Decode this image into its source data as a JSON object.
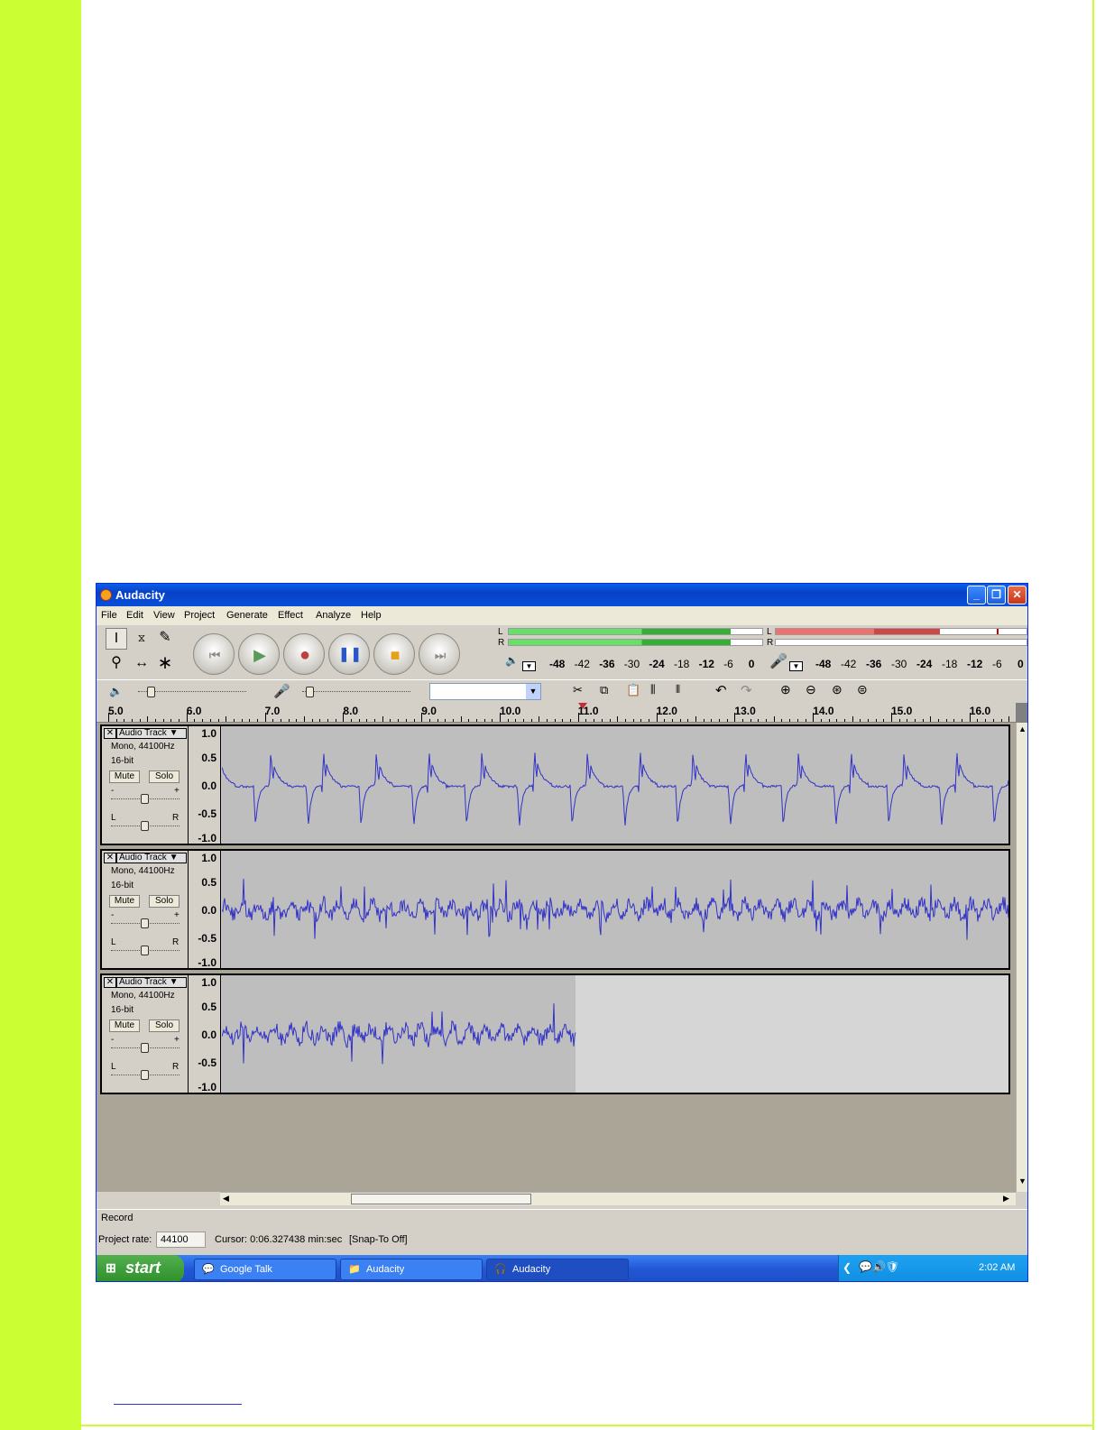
{
  "window": {
    "title": "Audacity",
    "minimize": "_",
    "restore": "❐",
    "close": "✕"
  },
  "menu": [
    "File",
    "Edit",
    "View",
    "Project",
    "Generate",
    "Effect",
    "Analyze",
    "Help"
  ],
  "meters": {
    "channel_l": "L",
    "channel_r": "R",
    "scale": [
      "-48",
      "-42",
      "-36",
      "-30",
      "-24",
      "-18",
      "-12",
      "-6",
      "0"
    ],
    "playback_level_l": 0.87,
    "playback_level_r": 0.87,
    "record_level_l": 0.65
  },
  "ruler": {
    "labels": [
      "5.0",
      "6.0",
      "7.0",
      "8.0",
      "9.0",
      "10.0",
      "11.0",
      "12.0",
      "13.0",
      "14.0",
      "15.0",
      "16.0"
    ]
  },
  "tracks": [
    {
      "name": "Audio Track",
      "format": "Mono, 44100Hz",
      "bits": "16-bit",
      "mute": "Mute",
      "solo": "Solo"
    },
    {
      "name": "Audio Track",
      "format": "Mono, 44100Hz",
      "bits": "16-bit",
      "mute": "Mute",
      "solo": "Solo"
    },
    {
      "name": "Audio Track",
      "format": "Mono, 44100Hz",
      "bits": "16-bit",
      "mute": "Mute",
      "solo": "Solo"
    }
  ],
  "vscale": [
    "1.0",
    "0.5",
    "0.0",
    "-0.5",
    "-1.0"
  ],
  "gain": {
    "minus": "-",
    "plus": "+",
    "left": "L",
    "right": "R"
  },
  "status": {
    "mode": "Record",
    "rate_label": "Project rate:",
    "rate_value": "44100",
    "cursor": "Cursor: 0:06.327438 min:sec",
    "snap": "[Snap-To Off]"
  },
  "taskbar": {
    "start": "start",
    "tasks": [
      "Google Talk",
      "Audacity",
      "Audacity"
    ],
    "clock": "2:02 AM"
  }
}
